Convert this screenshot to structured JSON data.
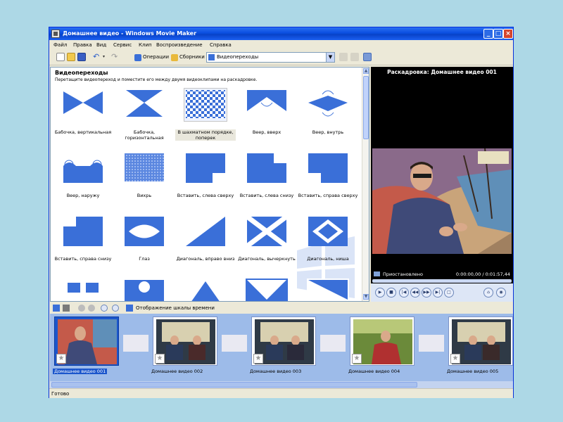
{
  "window": {
    "title": "Домашнее видео - Windows Movie Maker"
  },
  "menu": [
    "Файл",
    "Правка",
    "Вид",
    "Сервис",
    "Клип",
    "Воспроизведение",
    "Справка"
  ],
  "toolbar": {
    "operations_label": "Операции",
    "collections_label": "Сборники",
    "collection_combo_value": "Видеопереходы"
  },
  "content": {
    "heading": "Видеопереходы",
    "hint": "Перетащите видеопереход и поместите его между двумя видеоклипами на раскадровке.",
    "transitions": [
      {
        "label": "Бабочка, вертикальная",
        "icon": "butterfly-vertical"
      },
      {
        "label": "Бабочка, горизонтальная",
        "icon": "butterfly-horizontal"
      },
      {
        "label": "В шахматном порядке, поперек",
        "icon": "checkerboard"
      },
      {
        "label": "Веер, вверх",
        "icon": "fan-up"
      },
      {
        "label": "Веер, внутрь",
        "icon": "fan-in"
      },
      {
        "label": "Веер, наружу",
        "icon": "fan-out"
      },
      {
        "label": "Вихрь",
        "icon": "whirlwind"
      },
      {
        "label": "Вставить, слева сверху",
        "icon": "inset-top-left"
      },
      {
        "label": "Вставить, слева снизу",
        "icon": "inset-bottom-left"
      },
      {
        "label": "Вставить, справа сверху",
        "icon": "inset-top-right"
      },
      {
        "label": "Вставить, справа снизу",
        "icon": "inset-bottom-right"
      },
      {
        "label": "Глаз",
        "icon": "eye"
      },
      {
        "label": "Диагональ, вправо вниз",
        "icon": "diagonal-down-right"
      },
      {
        "label": "Диагональ, вычеркнуть",
        "icon": "diagonal-cross-out"
      },
      {
        "label": "Диагональ, ниша",
        "icon": "diagonal-box-out"
      }
    ]
  },
  "monitor": {
    "title": "Раскадровка: Домашнее видео 001",
    "status": "Приостановлено",
    "time": "0:00:00,00 / 0:01:57,44"
  },
  "storyboard_tools": {
    "timeline_label": "Отображение шкалы времени"
  },
  "storyboard": {
    "clips": [
      {
        "caption": "Домашнее видео 001",
        "selected": true
      },
      {
        "caption": "Домашнее видео 002",
        "selected": false
      },
      {
        "caption": "Домашнее видео 003",
        "selected": false
      },
      {
        "caption": "Домашнее видео 004",
        "selected": false
      },
      {
        "caption": "Домашнее видео 005",
        "selected": false
      }
    ]
  },
  "statusbar": {
    "text": "Готово"
  }
}
